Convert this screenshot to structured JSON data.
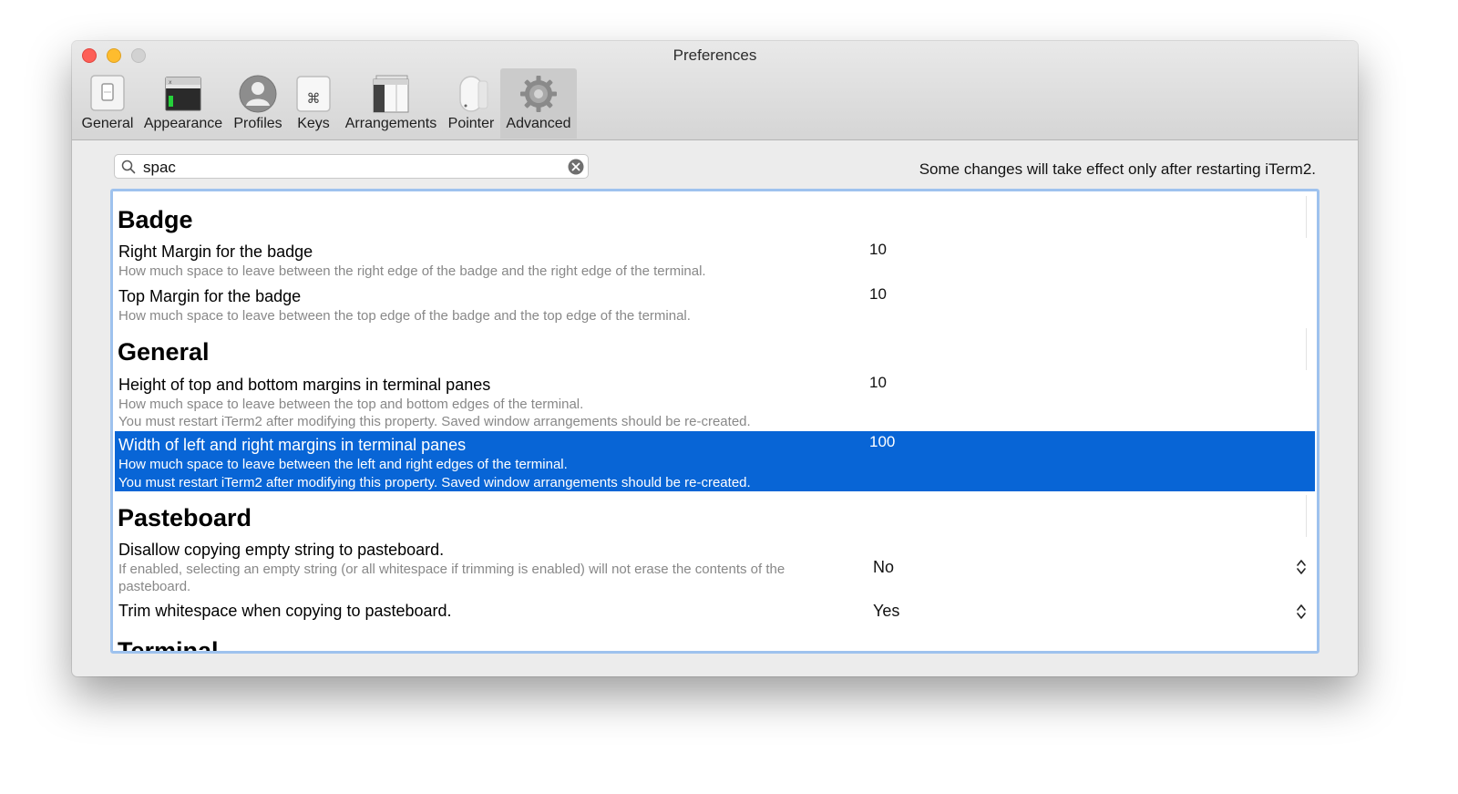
{
  "window": {
    "title": "Preferences"
  },
  "toolbar": {
    "items": [
      {
        "label": "General",
        "icon": "switch-icon"
      },
      {
        "label": "Appearance",
        "icon": "window-appearance-icon"
      },
      {
        "label": "Profiles",
        "icon": "person-icon"
      },
      {
        "label": "Keys",
        "icon": "command-key-icon"
      },
      {
        "label": "Arrangements",
        "icon": "window-stack-icon"
      },
      {
        "label": "Pointer",
        "icon": "mouse-icon"
      },
      {
        "label": "Advanced",
        "icon": "gear-icon",
        "selected": true
      }
    ]
  },
  "search": {
    "value": "spac"
  },
  "notice": "Some changes will take effect only after restarting iTerm2.",
  "sections": {
    "badge": {
      "title": "Badge",
      "rows": [
        {
          "title": "Right Margin for the badge",
          "desc": "How much space to leave between the right edge of the badge and the right edge of the terminal.",
          "value": "10"
        },
        {
          "title": "Top Margin for the badge",
          "desc": "How much space to leave between the top edge of the badge and the top edge of the terminal.",
          "value": "10"
        }
      ]
    },
    "general": {
      "title": "General",
      "rows": [
        {
          "title": "Height of top and bottom margins in terminal panes",
          "desc": "How much space to leave between the top and bottom edges of the terminal.",
          "desc2": "You must restart iTerm2 after modifying this property. Saved window arrangements should be re-created.",
          "value": "10"
        },
        {
          "title": "Width of left and right margins in terminal panes",
          "desc": "How much space to leave between the left and right edges of the terminal.",
          "desc2": "You must restart iTerm2 after modifying this property. Saved window arrangements should be re-created.",
          "value": "100",
          "selected": true
        }
      ]
    },
    "pasteboard": {
      "title": "Pasteboard",
      "rows": [
        {
          "title": "Disallow copying empty string to pasteboard.",
          "desc": "If enabled, selecting an empty string (or all whitespace if trimming is enabled) will not erase the contents of the",
          "desc2": "pasteboard.",
          "value": "No"
        },
        {
          "title": "Trim whitespace when copying to pasteboard.",
          "value": "Yes"
        }
      ]
    },
    "terminal": {
      "title": "Terminal"
    }
  },
  "colors": {
    "selection": "#0865d6",
    "focus_ring": "#9ec2ee",
    "close": "#fd5f57",
    "minimize": "#febc2e"
  }
}
